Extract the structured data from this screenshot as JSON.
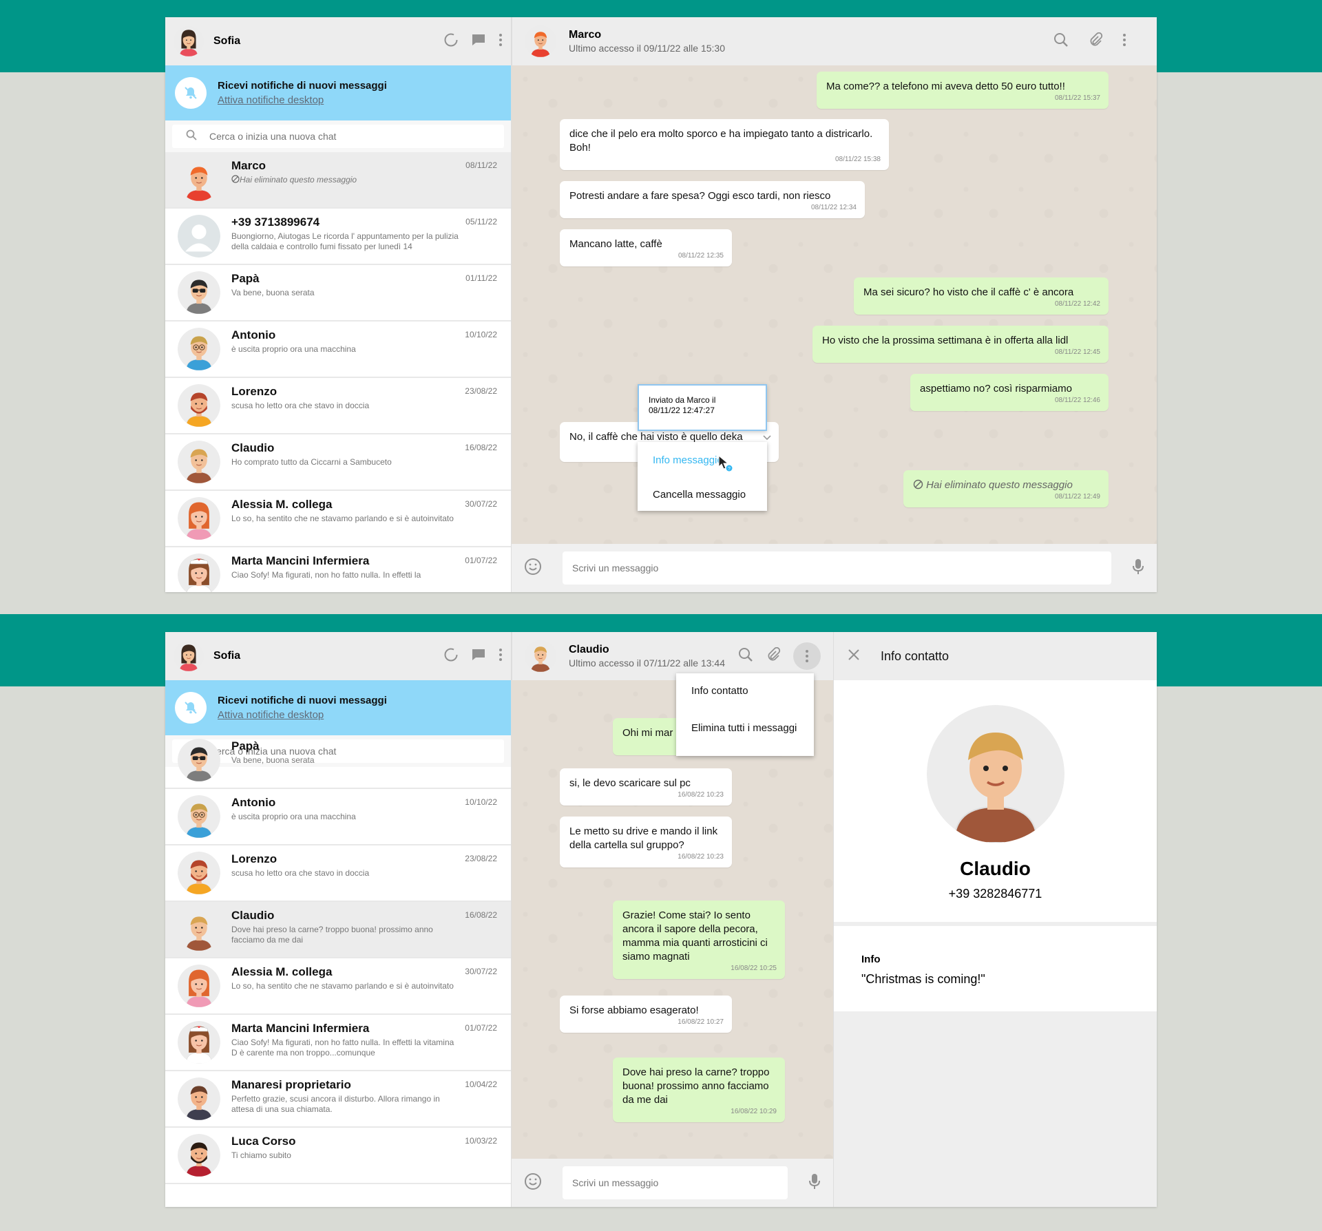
{
  "screen1": {
    "me": {
      "name": "Sofia"
    },
    "notification": {
      "title": "Ricevi notifiche di nuovi messaggi",
      "link": "Attiva notifiche desktop"
    },
    "search": {
      "placeholder": "Cerca o inizia una nuova chat"
    },
    "contacts": [
      {
        "name": "Marco",
        "msg": "Hai eliminato questo messaggio",
        "date": "08/11/22",
        "avatar": "marco",
        "deleted": true,
        "active": true
      },
      {
        "name": "+39 3713899674",
        "msg": "Buongiorno, Aiutogas Le ricorda l' appuntamento per la pulizia della caldaia e controllo fumi fissato per lunedì 14",
        "date": "05/11/22",
        "avatar": "default"
      },
      {
        "name": "Papà",
        "msg": "Va bene, buona serata",
        "date": "01/11/22",
        "avatar": "papa"
      },
      {
        "name": "Antonio",
        "msg": "è uscita proprio ora una macchina",
        "date": "10/10/22",
        "avatar": "antonio"
      },
      {
        "name": "Lorenzo",
        "msg": "scusa ho letto ora che stavo in doccia",
        "date": "23/08/22",
        "avatar": "lorenzo"
      },
      {
        "name": "Claudio",
        "msg": "Ho comprato tutto da Ciccarni a Sambuceto",
        "date": "16/08/22",
        "avatar": "claudio"
      },
      {
        "name": "Alessia M. collega",
        "msg": "Lo so, ha sentito che ne stavamo parlando e si è autoinvitato",
        "date": "30/07/22",
        "avatar": "alessia"
      },
      {
        "name": "Marta Mancini Infermiera",
        "msg": "Ciao Sofy! Ma figurati, non ho fatto nulla. In effetti la",
        "date": "01/07/22",
        "avatar": "marta"
      }
    ],
    "chat": {
      "name": "Marco",
      "status": "Ultimo accesso il 09/11/22 alle 15:30",
      "messages": [
        {
          "dir": "out",
          "text": "Ma come?? a telefono mi aveva detto 50 euro tutto!!",
          "time": "08/11/22 15:37"
        },
        {
          "dir": "in",
          "text": "dice che il pelo era molto sporco e ha impiegato tanto a districarlo. Boh!",
          "time": "08/11/22 15:38"
        },
        {
          "dir": "in",
          "text": "Potresti andare a fare spesa? Oggi esco tardi, non riesco",
          "time": "08/11/22 12:34"
        },
        {
          "dir": "in",
          "text": "Mancano latte, caffè",
          "time": "08/11/22 12:35"
        },
        {
          "dir": "out",
          "text": "Ma sei sicuro? ho visto che il caffè c' è ancora",
          "time": "08/11/22 12:42"
        },
        {
          "dir": "out",
          "text": "Ho visto che la prossima settimana è in offerta alla lidl",
          "time": "08/11/22 12:45"
        },
        {
          "dir": "out",
          "text": "aspettiamo no? così risparmiamo",
          "time": "08/11/22 12:46"
        },
        {
          "dir": "in",
          "text": "No, il caffè che hai visto è quello deka",
          "time": ""
        },
        {
          "dir": "out",
          "text": "Hai eliminato questo messaggio",
          "time": "08/11/22 12:49",
          "deleted": true
        }
      ],
      "tooltip": {
        "line1": "Inviato da Marco il",
        "line2": "08/11/22 12:47:27"
      },
      "menu": {
        "info": "Info messaggio",
        "delete": "Cancella messaggio"
      },
      "compose_placeholder": "Scrivi un messaggio"
    }
  },
  "screen2": {
    "me": {
      "name": "Sofia"
    },
    "notification": {
      "title": "Ricevi notifiche di nuovi messaggi",
      "link": "Attiva notifiche desktop"
    },
    "search": {
      "placeholder": "Cerca o inizia una nuova chat"
    },
    "contacts": [
      {
        "name": "Papà",
        "msg": "Va bene, buona serata",
        "date": "",
        "avatar": "papa"
      },
      {
        "name": "Antonio",
        "msg": "è uscita proprio ora una macchina",
        "date": "10/10/22",
        "avatar": "antonio"
      },
      {
        "name": "Lorenzo",
        "msg": "scusa ho letto ora che stavo in doccia",
        "date": "23/08/22",
        "avatar": "lorenzo"
      },
      {
        "name": "Claudio",
        "msg": "Dove hai preso la carne? troppo buona! prossimo anno facciamo da me dai",
        "date": "16/08/22",
        "avatar": "claudio",
        "active": true
      },
      {
        "name": "Alessia M. collega",
        "msg": "Lo so, ha sentito che ne stavamo parlando e si è autoinvitato",
        "date": "30/07/22",
        "avatar": "alessia"
      },
      {
        "name": "Marta Mancini Infermiera",
        "msg": "Ciao Sofy! Ma figurati, non ho fatto nulla. In effetti la vitamina D è carente ma non troppo...comunque",
        "date": "01/07/22",
        "avatar": "marta"
      },
      {
        "name": "Manaresi proprietario",
        "msg": "Perfetto grazie, scusi ancora il disturbo. Allora rimango in attesa di una sua chiamata.",
        "date": "10/04/22",
        "avatar": "manaresi"
      },
      {
        "name": "Luca Corso",
        "msg": "Ti chiamo subito",
        "date": "10/03/22",
        "avatar": "luca"
      }
    ],
    "chat": {
      "name": "Claudio",
      "status": "Ultimo accesso il 07/11/22 alle 13:44",
      "messages": [
        {
          "dir": "out",
          "text": "Ohi mi mar",
          "time": ""
        },
        {
          "dir": "in",
          "text": "si, le devo scaricare sul pc",
          "time": "16/08/22 10:23"
        },
        {
          "dir": "in",
          "text": "Le metto su drive e mando il link della cartella sul gruppo?",
          "time": "16/08/22 10:23"
        },
        {
          "dir": "out",
          "text": "Grazie! Come stai? Io sento ancora il sapore della pecora, mamma mia quanti arrosticini ci siamo magnati",
          "time": "16/08/22 10:25"
        },
        {
          "dir": "in",
          "text": "Si forse abbiamo esagerato!",
          "time": "16/08/22 10:27"
        },
        {
          "dir": "out",
          "text": "Dove hai preso la carne? troppo buona! prossimo anno facciamo da me dai",
          "time": "16/08/22 10:29"
        }
      ],
      "menu": {
        "info": "Info contatto",
        "delete": "Elimina tutti i messaggi"
      },
      "compose_placeholder": "Scrivi un messaggio"
    },
    "info_panel": {
      "title": "Info contatto",
      "name": "Claudio",
      "phone": "+39 3282846771",
      "info_label": "Info",
      "info_value": "\"Christmas is coming!\""
    }
  },
  "colors": {
    "brand": "#009688",
    "notify": "#8fd8f9",
    "bubble_out": "#dcf8c6",
    "bubble_in": "#ffffff",
    "link": "#34b7f1"
  },
  "icons": [
    "status-icon",
    "new-chat-icon",
    "menu-dots-icon",
    "bell-off-icon",
    "search-icon",
    "attach-icon",
    "emoji-icon",
    "mic-icon",
    "close-icon",
    "chevron-down-icon",
    "deleted-icon"
  ]
}
